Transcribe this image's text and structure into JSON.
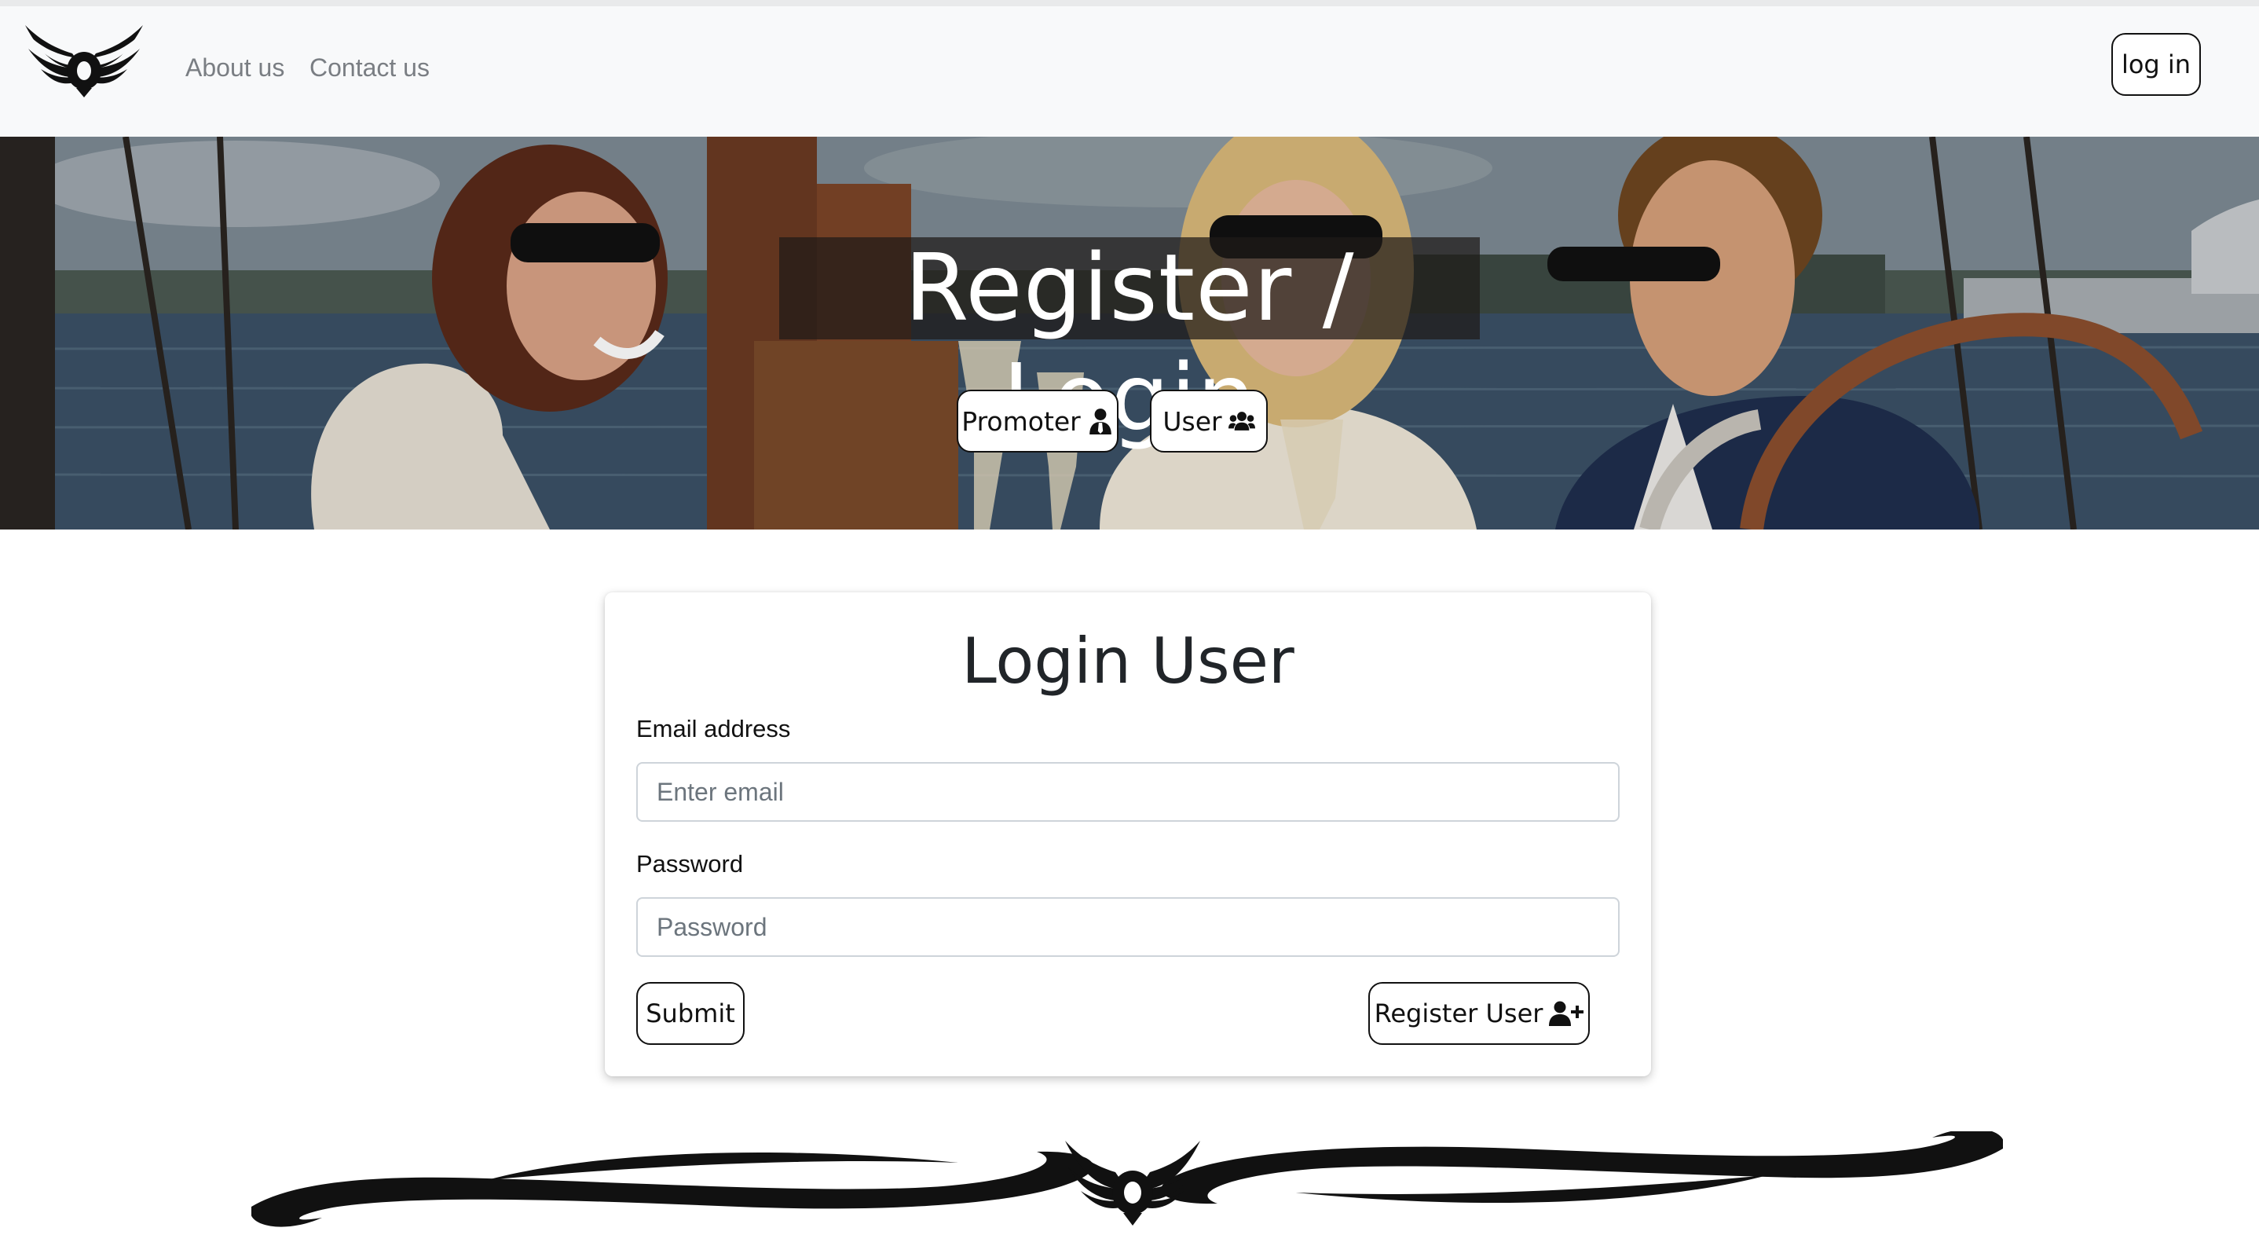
{
  "navbar": {
    "logo_icon": "winged-o-logo-icon",
    "links": [
      {
        "label": "About us"
      },
      {
        "label": "Contact us"
      }
    ],
    "login_label": "log in"
  },
  "hero": {
    "title": "Register / Login",
    "promoter_label": "Promoter",
    "promoter_icon": "user-tie-icon",
    "user_label": "User",
    "user_icon": "users-icon"
  },
  "login_form": {
    "title": "Login User",
    "email_label": "Email address",
    "email_placeholder": "Enter email",
    "email_value": "",
    "password_label": "Password",
    "password_placeholder": "Password",
    "password_value": "",
    "submit_label": "Submit",
    "register_label": "Register User",
    "register_icon": "user-plus-icon"
  },
  "footer": {
    "ornament_icon": "winged-o-flourish-icon"
  },
  "colors": {
    "navbar_bg": "#f8f9fa",
    "nav_link": "#7a7e83",
    "text": "#212529",
    "button_border": "#111111",
    "input_border": "#ced4da"
  }
}
